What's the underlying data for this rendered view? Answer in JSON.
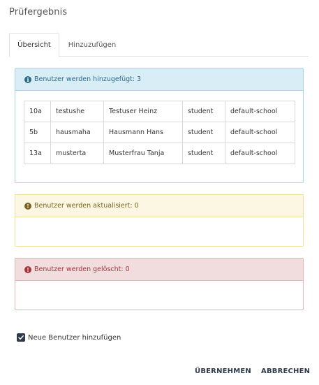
{
  "dialog": {
    "title": "Prüfergebnis"
  },
  "tabs": [
    {
      "label": "Übersicht",
      "active": true
    },
    {
      "label": "Hinzuzufügen",
      "active": false
    }
  ],
  "added": {
    "heading": "Benutzer werden hinzugefügt: 3",
    "icon": "info-icon",
    "rows": [
      [
        "10a",
        "testushe",
        "Testuser Heinz",
        "student",
        "default-school"
      ],
      [
        "5b",
        "hausmaha",
        "Hausmann Hans",
        "student",
        "default-school"
      ],
      [
        "13a",
        "musterta",
        "Musterfrau Tanja",
        "student",
        "default-school"
      ]
    ]
  },
  "updated": {
    "heading": "Benutzer werden aktualisiert: 0",
    "icon": "warning-icon"
  },
  "deleted": {
    "heading": "Benutzer werden gelöscht: 0",
    "icon": "alert-icon"
  },
  "option": {
    "label": "Neue Benutzer hinzufügen",
    "checked": true
  },
  "actions": {
    "apply": "ÜBERNEHMEN",
    "cancel": "ABBRECHEN"
  },
  "colors": {
    "info_bg": "#d8edf6",
    "info_text": "#2b6a86",
    "warn_bg": "#fcf7e2",
    "warn_text": "#7a6322",
    "danger_bg": "#f1dcde",
    "danger_text": "#a3353a",
    "primary": "#2e3a4a"
  }
}
